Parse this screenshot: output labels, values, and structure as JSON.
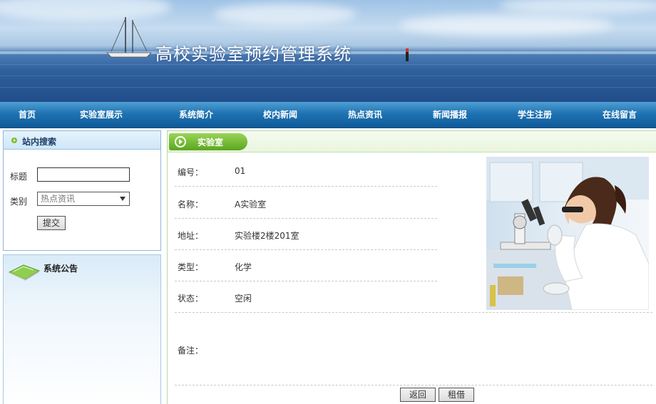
{
  "site": {
    "title": "高校实验室预约管理系统"
  },
  "nav": [
    {
      "label": "首页"
    },
    {
      "label": "实验室展示"
    },
    {
      "label": "系统简介"
    },
    {
      "label": "校内新闻"
    },
    {
      "label": "热点资讯"
    },
    {
      "label": "新闻播报"
    },
    {
      "label": "学生注册"
    },
    {
      "label": "在线留言"
    }
  ],
  "search": {
    "title": "站内搜索",
    "title_label": "标题",
    "title_value": "",
    "category_label": "类别",
    "category_value": "热点资讯",
    "submit_label": "提交"
  },
  "notice": {
    "title": "系统公告"
  },
  "lab": {
    "section_title": "实验室",
    "fields": [
      {
        "label": "编号：",
        "value": "01"
      },
      {
        "label": "名称：",
        "value": "A实验室"
      },
      {
        "label": "地址：",
        "value": "实验楼2楼201室"
      },
      {
        "label": "类型：",
        "value": "化学"
      },
      {
        "label": "状态：",
        "value": "空闲"
      }
    ],
    "note_label": "备注：",
    "note_value": "",
    "back_label": "返回",
    "rent_label": "租借"
  }
}
